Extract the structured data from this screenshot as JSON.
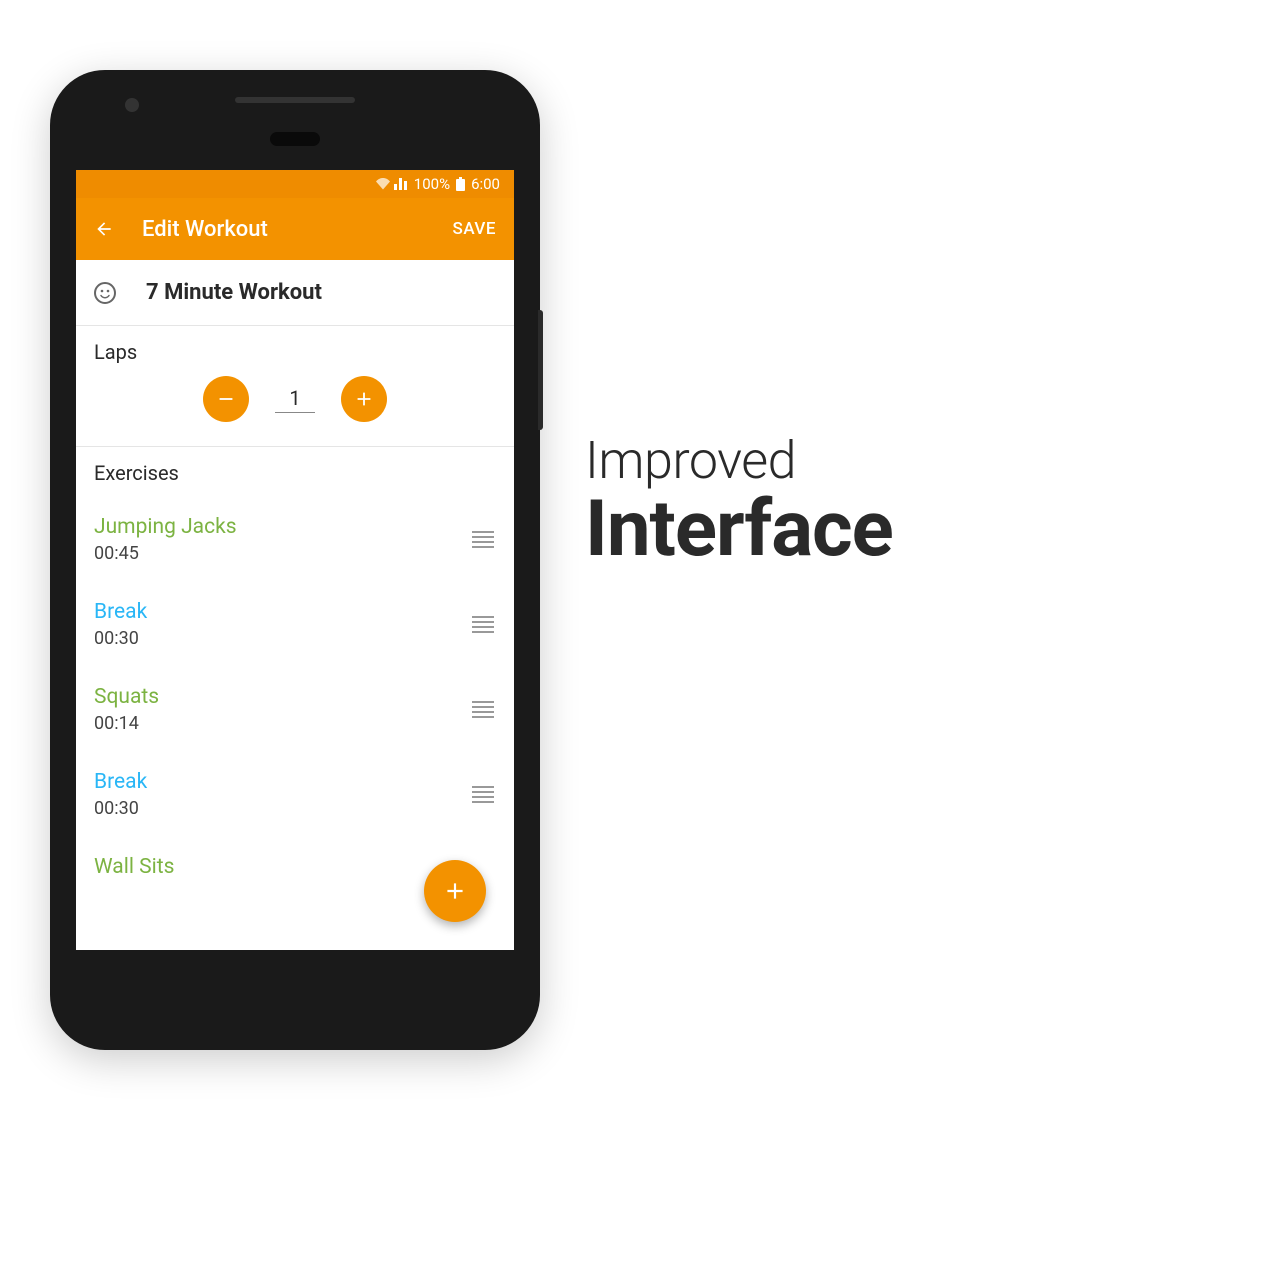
{
  "colors": {
    "accent": "#F39200",
    "statusbar": "#EF8C00",
    "green": "#7CB342",
    "blue": "#29B6F6"
  },
  "status": {
    "battery": "100%",
    "time": "6:00"
  },
  "appbar": {
    "title": "Edit Workout",
    "save": "SAVE"
  },
  "workout": {
    "name": "7 Minute Workout"
  },
  "sections": {
    "laps_label": "Laps",
    "exercises_label": "Exercises"
  },
  "laps": {
    "value": "1"
  },
  "exercises": [
    {
      "name": "Jumping Jacks",
      "time": "00:45",
      "type": "green"
    },
    {
      "name": "Break",
      "time": "00:30",
      "type": "blue"
    },
    {
      "name": "Squats",
      "time": "00:14",
      "type": "green"
    },
    {
      "name": "Break",
      "time": "00:30",
      "type": "blue"
    },
    {
      "name": "Wall Sits",
      "time": "",
      "type": "green"
    }
  ],
  "marketing": {
    "line1": "Improved",
    "line2": "Interface"
  }
}
